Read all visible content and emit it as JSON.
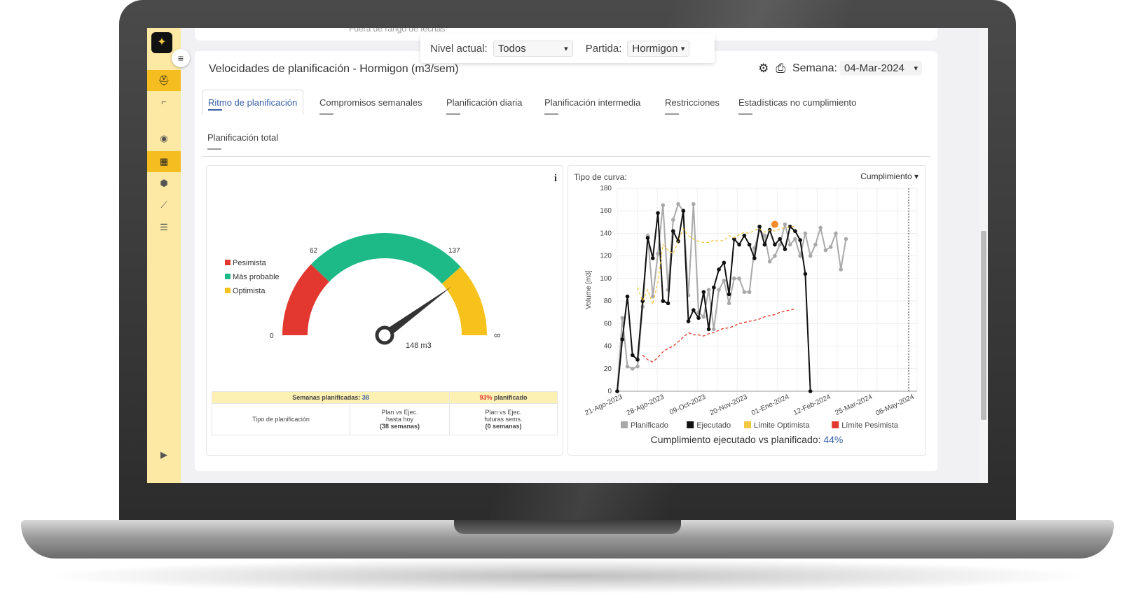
{
  "top_strip": {
    "text": "Fuera de rango de fechas"
  },
  "filters": {
    "nivel_label": "Nivel actual:",
    "nivel_value": "Todos",
    "partida_label": "Partida:",
    "partida_value": "Hormigon"
  },
  "header": {
    "title": "Velocidades de planificación - Hormigon (m3/sem)",
    "semana_label": "Semana:",
    "semana_value": "04-Mar-2024",
    "settings_icon": "gear-icon",
    "print_icon": "printer-icon"
  },
  "tabs": [
    {
      "label": "Ritmo de planificación",
      "active": true
    },
    {
      "label": "Compromisos semanales"
    },
    {
      "label": "Planificación diaria"
    },
    {
      "label": "Planificación intermedia"
    },
    {
      "label": "Restricciones"
    },
    {
      "label": "Estadísticas no cumplimiento"
    },
    {
      "label": "Planificación total"
    }
  ],
  "gauge": {
    "legend": [
      {
        "label": "Pesimista",
        "color": "#e2382f"
      },
      {
        "label": "Más probable",
        "color": "#1db987"
      },
      {
        "label": "Optimista",
        "color": "#f7c21c"
      }
    ],
    "tick_min": "0",
    "tick_low": "62",
    "tick_high": "137",
    "tick_max": "∞",
    "value": 148,
    "value_label": "148 m3"
  },
  "stats_table": {
    "semanas_label": "Semanas planificadas:",
    "semanas_value": "38",
    "pct_value": "93%",
    "pct_label": "planificado",
    "row_label": "Tipo de planificación",
    "col1_l1": "Plan vs Ejec.",
    "col1_l2": "hasta hoy",
    "col1_l3": "(38 semanas)",
    "col2_l1": "Plan vs Ejec.",
    "col2_l2": "futuras sems.",
    "col2_l3": "(0 semanas)"
  },
  "chart_panel": {
    "tipo_label": "Tipo de curva:",
    "tipo_value": "Cumplimiento",
    "footer_label": "Cumplimiento ejecutado vs planificado:",
    "footer_value": "44%"
  },
  "chart_data": {
    "type": "line",
    "ylabel": "Volume [m3]",
    "ylim": [
      0,
      180
    ],
    "yticks": [
      0,
      20,
      40,
      60,
      80,
      100,
      120,
      140,
      160,
      180
    ],
    "xtick_labels": [
      "21-Ago-2023",
      "28-Ago-2023",
      "09-Oct-2023",
      "20-Nov-2023",
      "01-Ene-2024",
      "12-Feb-2024",
      "25-Mar-2024",
      "06-May-2024"
    ],
    "x_count": 60,
    "grid": true,
    "legend_position": "bottom",
    "series": [
      {
        "name": "Planificado",
        "color": "#a9a9a9",
        "values": [
          0,
          65,
          22,
          20,
          22,
          75,
          138,
          84,
          122,
          165,
          90,
          152,
          166,
          160,
          85,
          166,
          70,
          66,
          90,
          55,
          90,
          98,
          78,
          100,
          100,
          88,
          88,
          127,
          143,
          138,
          115,
          120,
          130,
          148,
          130,
          135,
          120,
          140,
          120,
          130,
          145,
          125,
          128,
          140,
          108,
          135,
          null,
          null,
          null,
          null,
          null,
          null,
          null,
          null,
          null,
          null,
          null,
          null,
          null,
          null
        ]
      },
      {
        "name": "Ejecutado",
        "color": "#111111",
        "values": [
          0,
          46,
          84,
          32,
          28,
          80,
          136,
          118,
          158,
          80,
          78,
          142,
          133,
          160,
          62,
          72,
          65,
          88,
          55,
          92,
          108,
          114,
          86,
          135,
          130,
          138,
          130,
          118,
          146,
          130,
          143,
          130,
          135,
          126,
          146,
          142,
          134,
          104,
          0,
          null,
          null,
          null,
          null,
          null,
          null,
          null,
          null,
          null,
          null,
          null,
          null,
          null,
          null,
          null,
          null,
          null,
          null,
          null,
          null,
          null
        ]
      },
      {
        "name": "Límite Optimista",
        "color": "#f2c744",
        "values": [
          null,
          null,
          null,
          null,
          92,
          80,
          90,
          77,
          97,
          130,
          125,
          122,
          133,
          144,
          138,
          135,
          133,
          132,
          132,
          134,
          133,
          134,
          138,
          136,
          139,
          141,
          140,
          143,
          144,
          141,
          143,
          142,
          144,
          145,
          146,
          146,
          null,
          null,
          null,
          null,
          null,
          null,
          null,
          null,
          null,
          null,
          null,
          null,
          null,
          null,
          null,
          null,
          null,
          null,
          null,
          null,
          null,
          null,
          null,
          null
        ]
      },
      {
        "name": "Límite Pesimista",
        "color": "#e2382f",
        "values": [
          null,
          null,
          null,
          null,
          null,
          32,
          28,
          26,
          30,
          35,
          38,
          40,
          44,
          48,
          52,
          50,
          50,
          49,
          51,
          52,
          54,
          56,
          56,
          58,
          60,
          61,
          62,
          63,
          64,
          66,
          67,
          68,
          70,
          71,
          72,
          73,
          null,
          null,
          null,
          null,
          null,
          null,
          null,
          null,
          null,
          null,
          null,
          null,
          null,
          null,
          null,
          null,
          null,
          null,
          null,
          null,
          null,
          null,
          null,
          null
        ]
      }
    ]
  }
}
